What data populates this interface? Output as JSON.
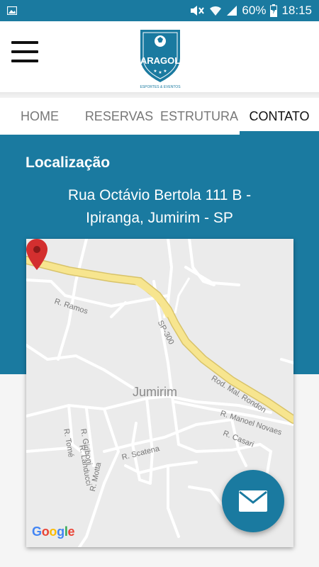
{
  "status_bar": {
    "battery_percent": "60%",
    "time": "18:15"
  },
  "logo": {
    "name": "ARAGOL",
    "tagline": "ESPORTES & EVENTOS"
  },
  "tabs": [
    {
      "label": "HOME",
      "active": false
    },
    {
      "label": "RESERVAS",
      "active": false
    },
    {
      "label": "ESTRUTURA",
      "active": false
    },
    {
      "label": "CONTATO",
      "active": true
    }
  ],
  "contact": {
    "title": "Localização",
    "address_line1": "Rua Octávio Bertola 111 B -",
    "address_line2": "Ipiranga, Jumirim - SP"
  },
  "map": {
    "town": "Jumirim",
    "streets": [
      "R. Ramos",
      "SP-300",
      "Rod. Mal. Rondon",
      "R. Giriboni",
      "R. Landucci",
      "R. Tomé",
      "R. Manoel Novaes",
      "R. Casari",
      "R. Scatena",
      "R. Motta"
    ],
    "attribution": "Google"
  },
  "colors": {
    "primary": "#1a7aa0",
    "marker": "#d32f2f",
    "highway": "#f7e58f"
  },
  "icons": {
    "menu": "hamburger-menu-icon",
    "email": "envelope-icon",
    "marker": "map-pin-icon"
  }
}
